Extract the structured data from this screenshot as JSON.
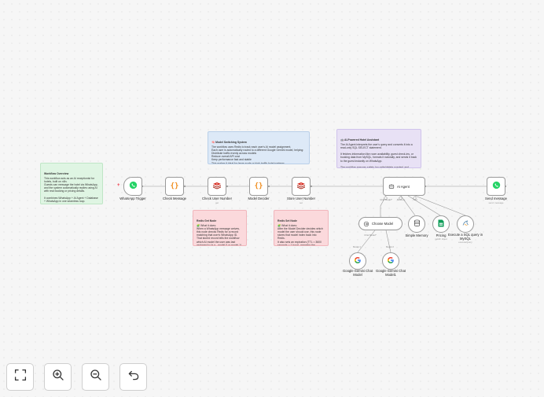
{
  "stickies": {
    "overview": {
      "title": "Workflow Overview",
      "body": "This workflow acts as an AI receptionist for hotels, built on n8n.\nGuests can message the hotel via WhatsApp, and the system automatically replies using AI with real booking or pricing details.\n\nIt combines WhatsApp + AI Agent + Database + WhatsApp in one seamless loop."
    },
    "model_switching": {
      "title": "🧠 Model Switching System",
      "body": "The workflow uses Redis to track each user's AI model assignment.\nEach user is automatically routed to a different Google Gemini model, helping:\nDistribute traffic evenly across models\nReduce overall API cost\nKeep performance fast and stable\nThis makes it ideal for large-scale or high-traffic hotel systems."
    },
    "ai_assistant": {
      "title": "🤖 AI-Powered Hotel Assistant",
      "body": "The AI Agent interprets the user's query and converts it into a read-only SQL SELECT statement.\n\nIt fetches information like room availability, guest check-ins, or booking data from MySQL, formats it naturally, and sends it back to the guest instantly on WhatsApp.\n\nThe workflow ensures safety (no write/delete queries) and delivers accurate, real-time hotel insights."
    },
    "redis_get": {
      "title": "Redis Get Node",
      "body": "🧩 What it does:\nWhen a WhatsApp message arrives, this node checks Redis for a record matching that user's WhatsApp ID.\nThat stored record tells the workflow which AI model the user was last assigned to (e.g., model 0 or model 1)."
    },
    "redis_set": {
      "title": "Redis Set Node",
      "body": "🧩 What it does:\nAfter the Model Decider decides which model the user should use, this node stores that model index back into Redis.\nIt also sets an expiration (TTL = 3600 seconds = 1 hour), meaning the assignment lasts for one hour."
    }
  },
  "nodes": {
    "whatsapp_trigger": {
      "label": "WhatsApp Trigger",
      "icon": "whatsapp-icon",
      "color": "#25d366"
    },
    "check_message": {
      "label": "Check Message",
      "icon": "code-braces-icon",
      "color": "#f08d1e"
    },
    "check_user_number": {
      "label": "Check User Number",
      "sub": "get",
      "icon": "redis-icon",
      "color": "#d82c20"
    },
    "model_decider": {
      "label": "Model Decider",
      "icon": "code-braces-icon",
      "color": "#f08d1e"
    },
    "store_user_number": {
      "label": "Store User Number",
      "sub": "set",
      "icon": "redis-icon",
      "color": "#d82c20"
    },
    "ai_agent": {
      "label": "AI Agent",
      "icon": "robot-icon"
    },
    "send_message": {
      "label": "Send message",
      "sub": "send: message",
      "icon": "whatsapp-icon",
      "color": "#25d366"
    },
    "choose_model": {
      "label": "Choose Model",
      "icon": "model-selector-icon"
    },
    "simple_memory": {
      "label": "Simple Memory",
      "icon": "database-icon"
    },
    "pricing": {
      "label": "Pricing",
      "sub": "getAll: sheet",
      "icon": "sheets-icon",
      "color": "#0f9d58"
    },
    "execute_sql": {
      "label": "Execute a SQL query in MySQL",
      "sub": "executeQuery",
      "icon": "mysql-icon"
    },
    "gemini_model": {
      "label": "Google Gemini Chat Model",
      "icon": "google-g-icon"
    },
    "gemini_model1": {
      "label": "Google Gemini Chat Model1",
      "icon": "google-g-icon"
    }
  },
  "ports": {
    "chat_model": "Chat Model*",
    "memory": "Memory",
    "tool": "Tool",
    "model1": "Model 1",
    "model2": "Model 2"
  },
  "controls": {
    "fit_view": "fit-view-icon",
    "zoom_in": "zoom-in-icon",
    "zoom_out": "zoom-out-icon",
    "undo": "undo-icon"
  },
  "colors": {
    "edge": "#9a9a9a",
    "accent": "#ff6d5a"
  }
}
